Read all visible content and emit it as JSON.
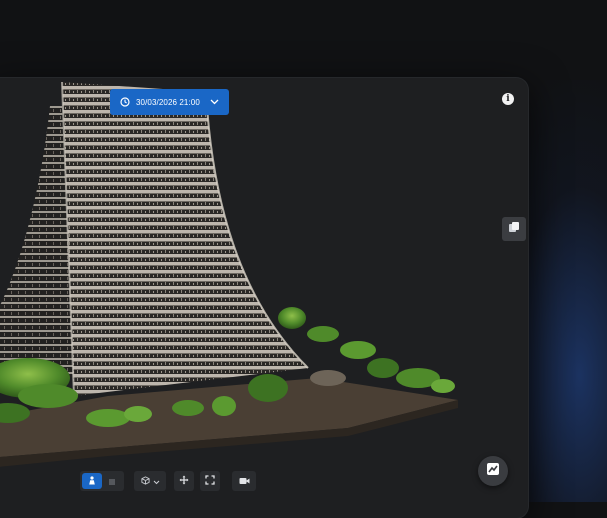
{
  "viewer": {
    "date_label": "30/03/2026 21:00",
    "info_label": "i"
  },
  "icons": {
    "clock": "clock-icon",
    "chevron": "chevron-down-icon",
    "info": "info-icon",
    "layers": "layers-icon",
    "person": "person-icon",
    "square": "square-icon",
    "cube": "cube-icon",
    "move": "move-icon",
    "fullscreen": "fullscreen-icon",
    "camera": "video-camera-icon",
    "map": "map-icon"
  },
  "colors": {
    "accent": "#1a67c6",
    "viewer_bg": "#1e1f21"
  }
}
